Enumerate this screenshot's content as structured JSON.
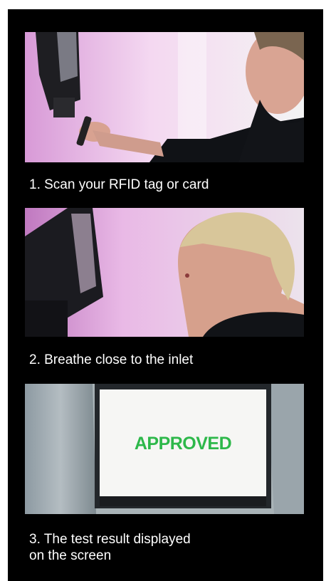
{
  "steps": [
    {
      "caption": "1. Scan your RFID tag or card"
    },
    {
      "caption": "2. Breathe close to the inlet"
    },
    {
      "caption": "3. The test result displayed\n   on the screen"
    }
  ],
  "screen": {
    "result_text": "APPROVED",
    "result_color": "#2db84a"
  }
}
